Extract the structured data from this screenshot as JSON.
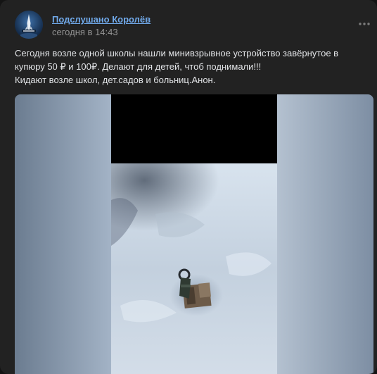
{
  "post": {
    "author": "Подслушано Королёв",
    "date": "сегодня в 14:43",
    "text_lines": [
      "Сегодня возле одной школы нашли минивзрывное устройство завёрнутое в",
      "купюру 50 ₽ и 100₽. Делают для детей, чтоб поднимали!!!",
      "Кидают возле школ, дет.садов и больниц.Анон."
    ]
  },
  "icons": {
    "avatar": "korolev-logo",
    "menu": "more-horizontal-icon"
  },
  "colors": {
    "background": "#222222",
    "author_link": "#71aaeb",
    "text": "#e1e3e6",
    "secondary_text": "#939393"
  }
}
